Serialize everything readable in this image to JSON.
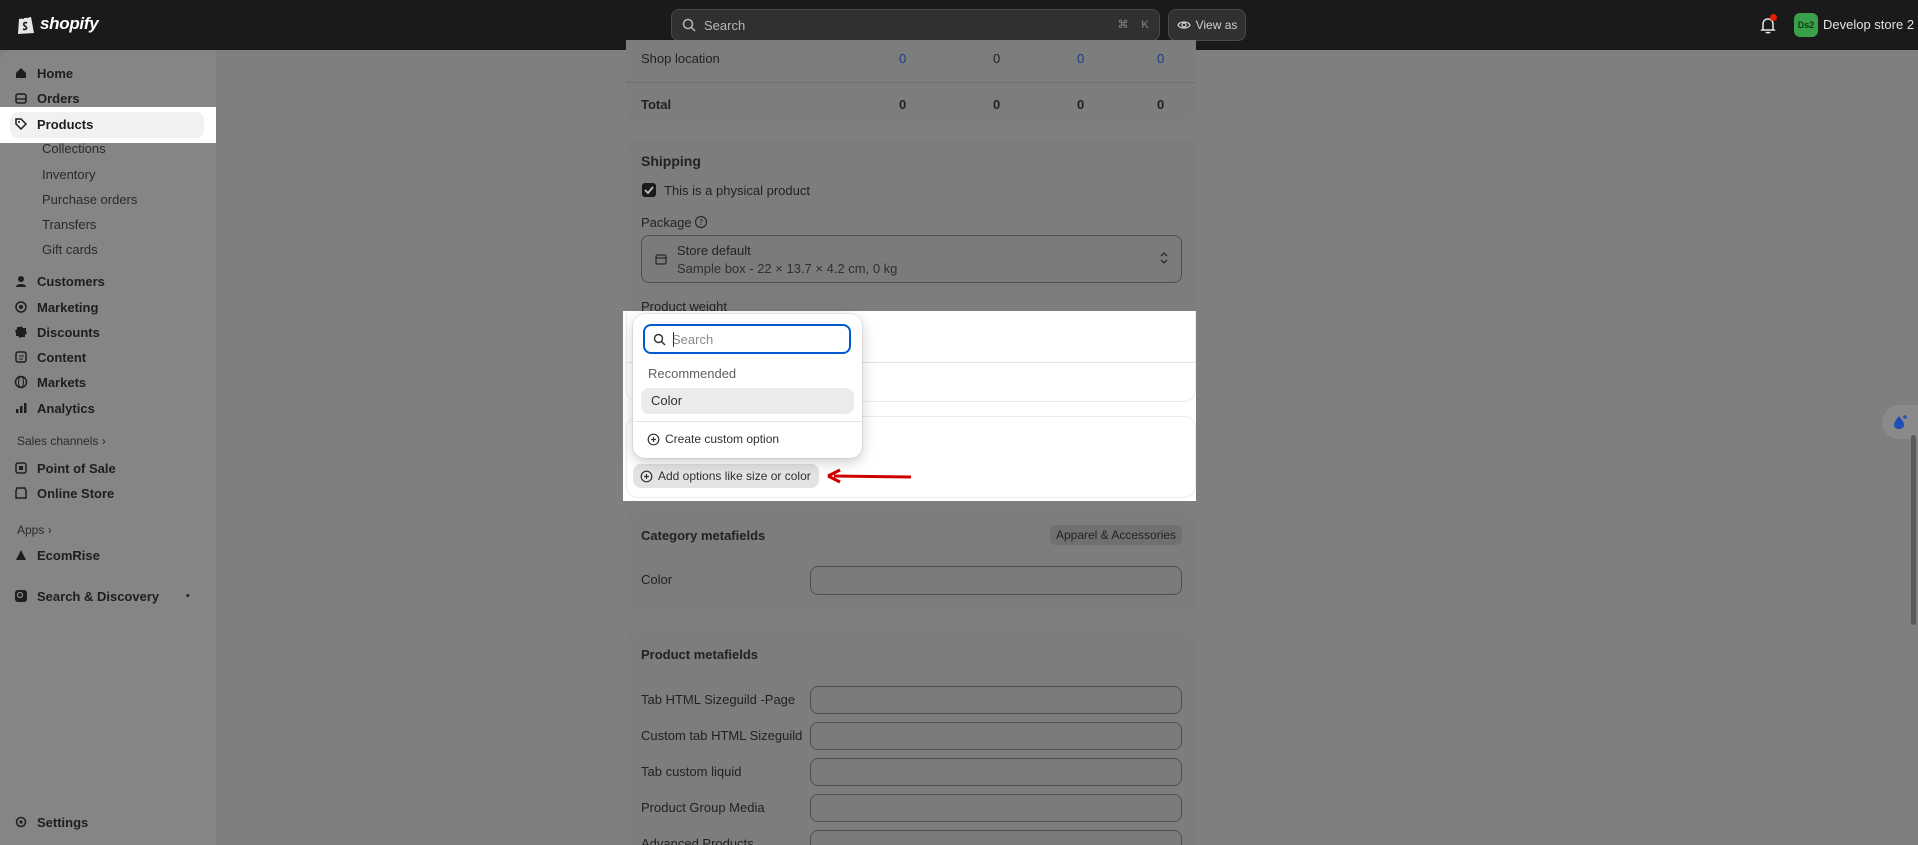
{
  "app": {
    "brand": "shopify"
  },
  "topbar": {
    "search_placeholder": "Search",
    "shortcut_cmd": "⌘",
    "shortcut_key": "K",
    "view_as": "View as",
    "store_initials": "Ds2",
    "store_name": "Develop store 2"
  },
  "sidebar": {
    "home": "Home",
    "orders": "Orders",
    "products": "Products",
    "collections": "Collections",
    "inventory": "Inventory",
    "purchase_orders": "Purchase orders",
    "transfers": "Transfers",
    "gift_cards": "Gift cards",
    "customers": "Customers",
    "marketing": "Marketing",
    "discounts": "Discounts",
    "content": "Content",
    "markets": "Markets",
    "analytics": "Analytics",
    "sales_channels": "Sales channels",
    "point_of_sale": "Point of Sale",
    "online_store": "Online Store",
    "apps": "Apps",
    "ecomrise": "EcomRise",
    "search_discovery": "Search & Discovery",
    "settings": "Settings"
  },
  "inventory_table": {
    "rows": [
      {
        "label": "Shop location",
        "values": [
          "0",
          "0",
          "0",
          "0"
        ]
      },
      {
        "label": "Total",
        "values": [
          "0",
          "0",
          "0",
          "0"
        ]
      }
    ]
  },
  "shipping": {
    "title": "Shipping",
    "physical_label": "This is a physical product",
    "physical_checked": true,
    "package_label": "Package",
    "package_name": "Store default",
    "package_detail": "Sample box - 22 × 13.7 × 4.2 cm, 0 kg",
    "weight_label": "Product weight"
  },
  "variants": {
    "add_options_label": "Add options like size or color"
  },
  "option_popover": {
    "search_placeholder": "Search",
    "recommended_heading": "Recommended",
    "recommended_items": [
      "Color"
    ],
    "create_custom": "Create custom option"
  },
  "category_metafields": {
    "title": "Category metafields",
    "badge": "Apparel & Accessories",
    "fields": [
      "Color"
    ]
  },
  "product_metafields": {
    "title": "Product metafields",
    "fields": [
      "Tab HTML Sizeguild -Page",
      "Custom tab HTML Sizeguild",
      "Tab custom liquid",
      "Product Group Media",
      "Advanced Products"
    ]
  },
  "colors": {
    "accent_focus": "#005bd3",
    "annotation_arrow": "#d10000",
    "store_avatar": "#3aa14a"
  }
}
